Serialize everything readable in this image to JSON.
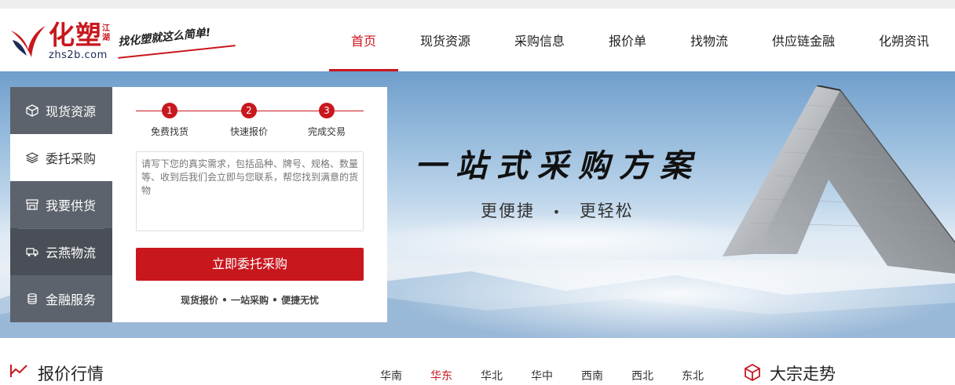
{
  "logo": {
    "brand": "化塑",
    "sub": "江湖",
    "url": "zhs2b.com",
    "slogan": "找化塑就这么简单!"
  },
  "nav": {
    "items": [
      {
        "label": "首页",
        "active": true
      },
      {
        "label": "现货资源"
      },
      {
        "label": "采购信息"
      },
      {
        "label": "报价单"
      },
      {
        "label": "找物流"
      },
      {
        "label": "供应链金融"
      },
      {
        "label": "化朔资讯"
      }
    ]
  },
  "sidebar": {
    "items": [
      {
        "label": "现货资源",
        "icon": "cube-icon"
      },
      {
        "label": "委托采购",
        "icon": "layers-icon",
        "active": true
      },
      {
        "label": "我要供货",
        "icon": "store-icon"
      },
      {
        "label": "云燕物流",
        "icon": "truck-icon"
      },
      {
        "label": "金融服务",
        "icon": "coins-icon"
      }
    ]
  },
  "panel": {
    "steps": [
      {
        "num": "1",
        "label": "免费找货"
      },
      {
        "num": "2",
        "label": "快速报价"
      },
      {
        "num": "3",
        "label": "完成交易"
      }
    ],
    "placeholder": "请写下您的真实需求，包括品种、牌号、规格、数量等、收到后我们会立即与您联系，帮您找到满意的货物",
    "button": "立即委托采购",
    "footer": "现货报价 • 一站采购 • 便捷无忧"
  },
  "banner": {
    "slogan": "一站式采购方案",
    "subslogan_left": "更便捷",
    "subslogan_dot": "•",
    "subslogan_right": "更轻松"
  },
  "quotes": {
    "title": "报价行情",
    "regions": [
      {
        "label": "华南"
      },
      {
        "label": "华东",
        "active": true
      },
      {
        "label": "华北"
      },
      {
        "label": "华中"
      },
      {
        "label": "西南"
      },
      {
        "label": "西北"
      },
      {
        "label": "东北"
      }
    ]
  },
  "bulk": {
    "title": "大宗走势"
  },
  "colors": {
    "accent": "#c9171e",
    "sidebar": "#4a4f57"
  }
}
